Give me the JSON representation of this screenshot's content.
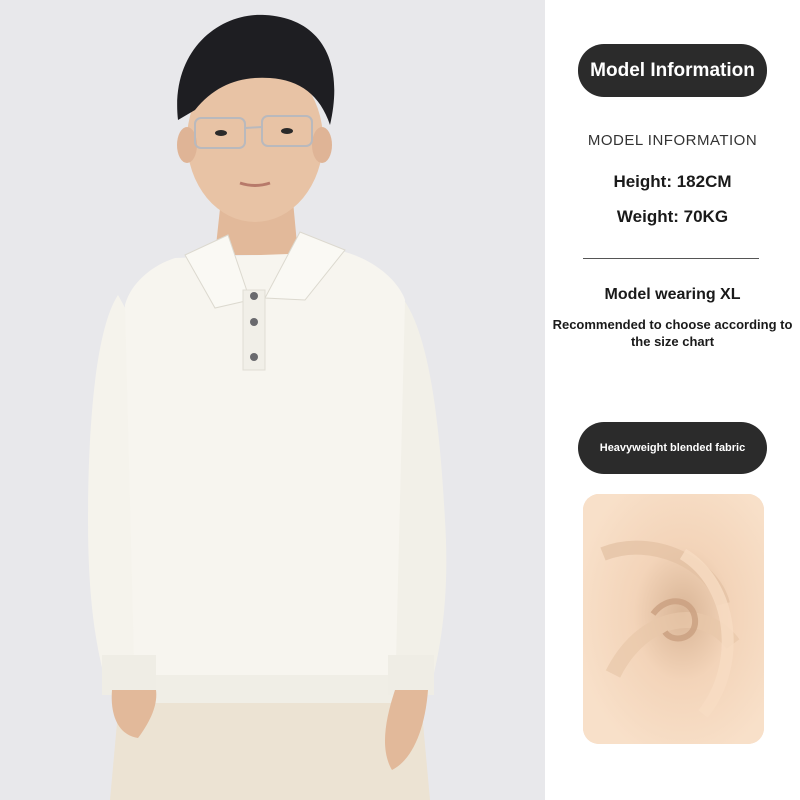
{
  "model_panel": {
    "header_pill": "Model Information",
    "section_label": "MODEL INFORMATION",
    "height": "Height: 182CM",
    "weight": "Weight: 70KG",
    "wearing": "Model wearing XL",
    "recommendation": "Recommended to choose according to the size chart"
  },
  "fabric_panel": {
    "pill": "Heavyweight blended fabric"
  },
  "colors": {
    "pill_background": "#2b2b2b",
    "sweater": "#f7f5ef",
    "fabric_swatch": "#f5d7bd",
    "photo_background": "#e9e9ec"
  }
}
